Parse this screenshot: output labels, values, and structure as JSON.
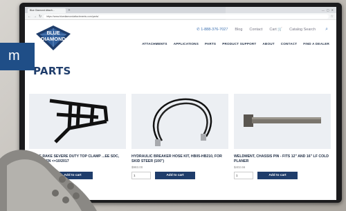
{
  "browser": {
    "tab_title": "Blue Diamond Attach...",
    "new_tab": "+",
    "window_controls": [
      "—",
      "▢",
      "✕"
    ],
    "url": "https://www.bluediamondattachments.com/parts/"
  },
  "header": {
    "phone": "1-888-376-7027",
    "links": [
      "Blog",
      "Contact",
      "Cart"
    ],
    "search_placeholder": "Catalog Search",
    "logo_line1": "BLUE",
    "logo_line2": "DIAMOND"
  },
  "nav": [
    "ATTACHMENTS",
    "APPLICATIONS",
    "PARTS",
    "PRODUCT SUPPORT",
    "ABOUT",
    "CONTACT",
    "FIND A DEALER"
  ],
  "page_title": "PARTS",
  "overlay_badge": "m",
  "products": [
    {
      "name": "...PPLE RAKE SEVERE DUTY TOP CLAMP ...EE SDC, ...CHECK SN <=10/2017",
      "price": "$...00",
      "qty": "1",
      "button": "Add to cart"
    },
    {
      "name": "HYDRAULIC BREAKER HOSE KIT, HB05-HB210, FOR SKID STEER (100\")",
      "price": "$983.00",
      "qty": "1",
      "button": "Add to cart"
    },
    {
      "name": "WELDMENT, CHASSIS PIN - FITS 12\" AND 16\" LF COLD PLANER",
      "price": "$402.66",
      "qty": "1",
      "button": "Add to cart"
    }
  ]
}
